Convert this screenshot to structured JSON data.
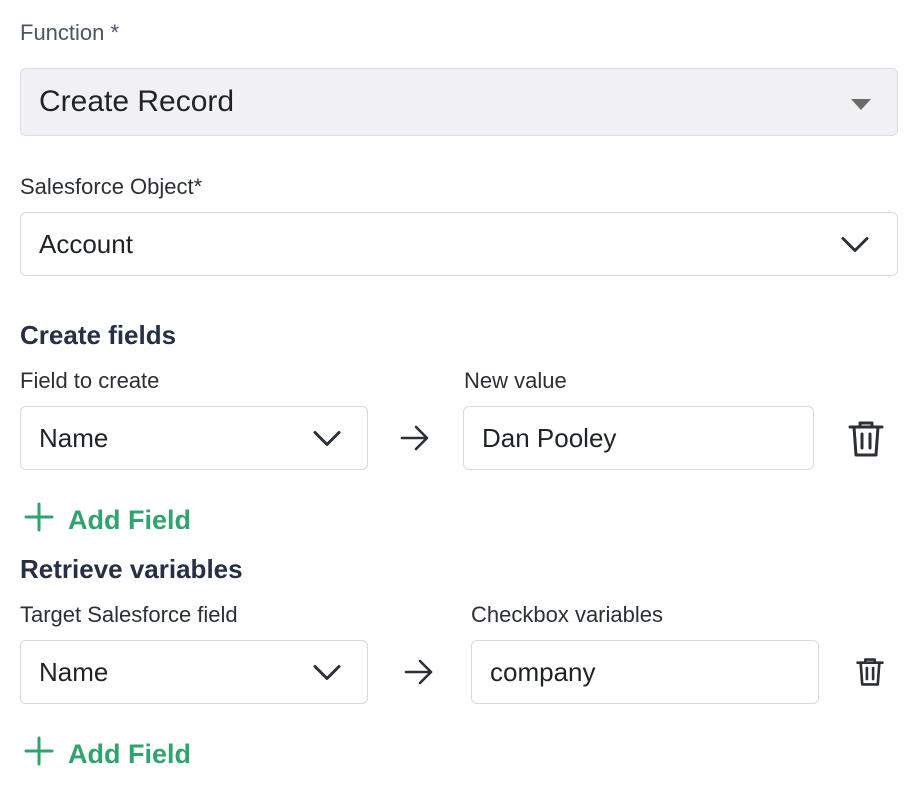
{
  "function": {
    "label": "Function *",
    "value": "Create Record"
  },
  "salesforce_object": {
    "label": "Salesforce Object*",
    "value": "Account"
  },
  "create_fields": {
    "heading": "Create fields",
    "field_label": "Field to create",
    "value_label": "New value",
    "rows": [
      {
        "field": "Name",
        "value": "Dan Pooley"
      }
    ],
    "add_label": "Add Field"
  },
  "retrieve_variables": {
    "heading": "Retrieve variables",
    "field_label": "Target Salesforce field",
    "value_label": "Checkbox variables",
    "rows": [
      {
        "field": "Name",
        "value": "company"
      }
    ],
    "add_label": "Add Field"
  },
  "colors": {
    "accent_green": "#2fa46f",
    "heading": "#253045",
    "border": "#d7d9de",
    "select_gray_bg": "#f1f1f3"
  },
  "icons": [
    "caret-down-icon",
    "chevron-down-icon",
    "arrow-right-icon",
    "trash-icon",
    "plus-icon"
  ]
}
